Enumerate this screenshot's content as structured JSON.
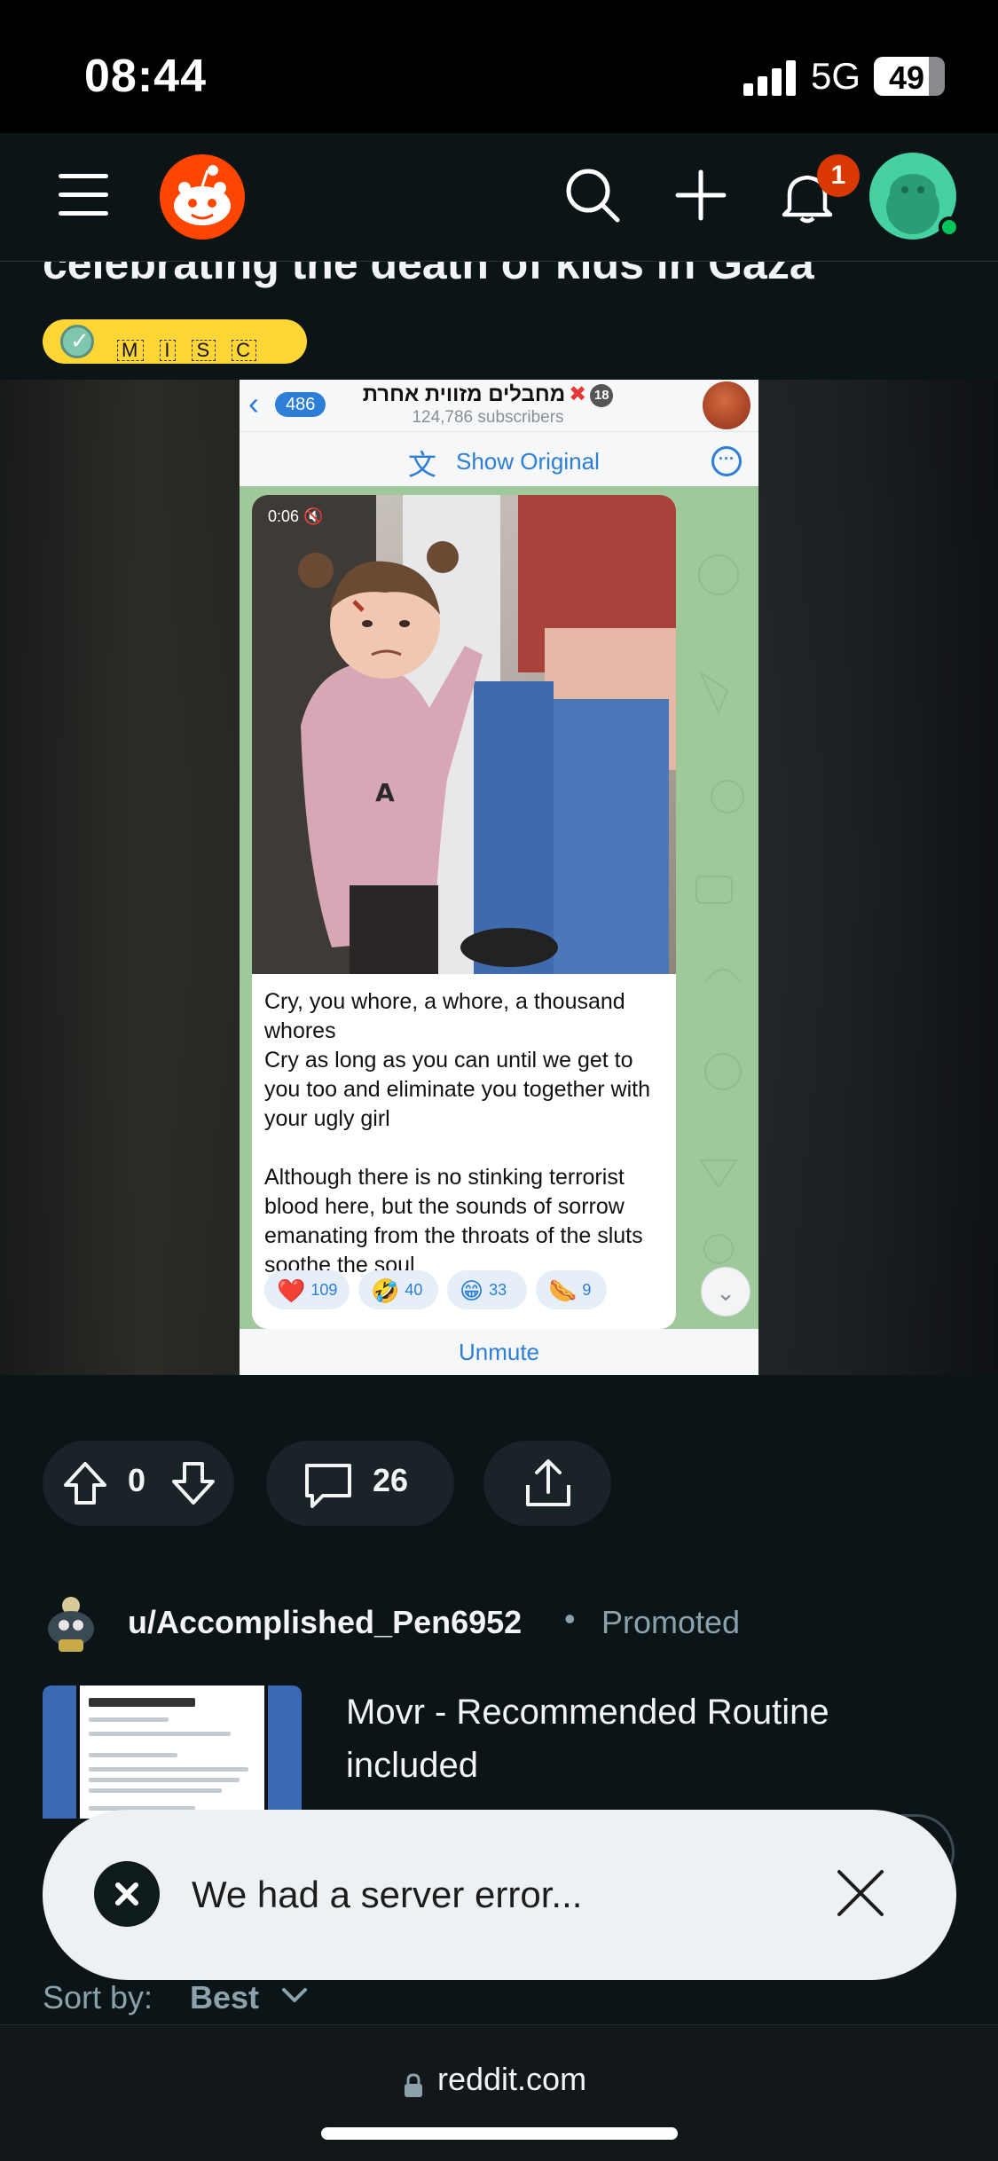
{
  "status_bar": {
    "time": "08:44",
    "network": "5G",
    "battery": "49"
  },
  "header": {
    "menu_icon": "hamburger-icon",
    "logo_icon": "reddit-snoo-icon",
    "search_icon": "search-icon",
    "create_icon": "plus-icon",
    "notifications_icon": "bell-icon",
    "notification_count": "1",
    "avatar_icon": "snoo-avatar-icon"
  },
  "post": {
    "title": "celebrating the death of kids in Gaza",
    "flair": [
      "M",
      "I",
      "S",
      "C"
    ],
    "embed": {
      "back_count": "486",
      "channel_name": "מחבלים מזווית אחרת",
      "subscribers": "124,786 subscribers",
      "show_original": "Show Original",
      "video_time": "0:06 🔇",
      "paragraph_1": "Cry, you whore, a whore, a thousand whores\nCry as long as you can until we get to you too and eliminate you together with your ugly girl",
      "paragraph_2": "Although there is no stinking terrorist blood here, but the sounds of sorrow emanating from the throats of the sluts soothe the soul",
      "reactions": [
        {
          "emoji": "❤️",
          "count": "109"
        },
        {
          "emoji": "🤣",
          "count": "40"
        },
        {
          "emoji": "😁",
          "count": "33"
        },
        {
          "emoji": "🌭",
          "count": "9"
        }
      ],
      "unmute": "Unmute"
    },
    "votes": "0",
    "comments": "26"
  },
  "promoted": {
    "username": "u/Accomplished_Pen6952",
    "separator": "•",
    "label": "Promoted",
    "ad_title": "Movr - Recommended Routine included"
  },
  "toast": {
    "message": "We had a server error..."
  },
  "sort": {
    "label": "Sort by:",
    "value": "Best"
  },
  "browser": {
    "url": "reddit.com"
  }
}
